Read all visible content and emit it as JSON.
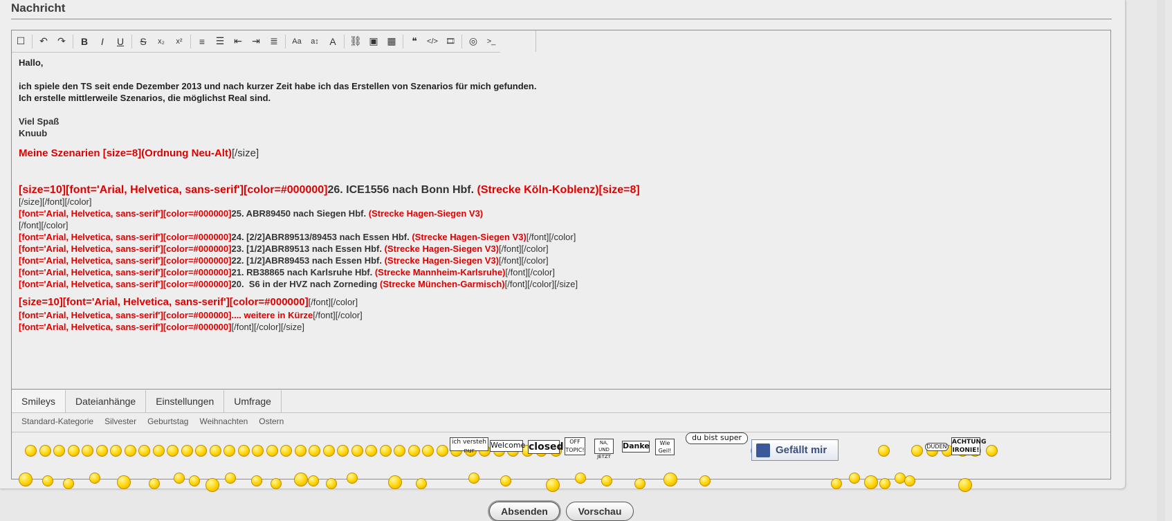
{
  "section_heading": "Nachricht",
  "toolbar": {
    "buttons": [
      {
        "name": "source-mode-icon",
        "glyph": "☐"
      },
      {
        "name": "undo-icon",
        "glyph": "↶"
      },
      {
        "name": "redo-icon",
        "glyph": "↷"
      },
      {
        "name": "bold-icon",
        "glyph": "B"
      },
      {
        "name": "italic-icon",
        "glyph": "I"
      },
      {
        "name": "underline-icon",
        "glyph": "U"
      },
      {
        "name": "strikethrough-icon",
        "glyph": "S"
      },
      {
        "name": "subscript-icon",
        "glyph": "x₂"
      },
      {
        "name": "superscript-icon",
        "glyph": "x²"
      },
      {
        "name": "ordered-list-icon",
        "glyph": "≡"
      },
      {
        "name": "unordered-list-icon",
        "glyph": "☰"
      },
      {
        "name": "outdent-icon",
        "glyph": "⇤"
      },
      {
        "name": "indent-icon",
        "glyph": "⇥"
      },
      {
        "name": "align-icon",
        "glyph": "≣"
      },
      {
        "name": "font-family-icon",
        "glyph": "Aa"
      },
      {
        "name": "font-size-icon",
        "glyph": "a↕"
      },
      {
        "name": "font-color-icon",
        "glyph": "A"
      },
      {
        "name": "link-icon",
        "glyph": "⛓"
      },
      {
        "name": "image-icon",
        "glyph": "▣"
      },
      {
        "name": "table-icon",
        "glyph": "▦"
      },
      {
        "name": "quote-icon",
        "glyph": "❝"
      },
      {
        "name": "code-icon",
        "glyph": "</>"
      },
      {
        "name": "media-icon",
        "glyph": "🎞"
      },
      {
        "name": "spoiler-icon",
        "glyph": "◎"
      },
      {
        "name": "terminal-icon",
        "glyph": ">_"
      }
    ]
  },
  "message": {
    "greeting": "Hallo,",
    "p1": "ich spiele den TS seit ende Dezember 2013 und nach kurzer Zeit habe ich das Erstellen von Szenarios für mich gefunden.",
    "p2": "Ich erstelle mittlerweile Szenarios, die möglichst Real sind.",
    "sign1": "Viel Spaß",
    "sign2": "Knuub",
    "scen_head_red": "Meine Szenarien [size=8](Ordnung Neu-Alt)",
    "scen_head_tail": "[/size]",
    "l26_red": "[size=10][font='Arial, Helvetica, sans-serif'][color=#000000]",
    "l26_black": "26. ICE1556 nach Bonn Hbf. ",
    "l26_route": "(Strecke Köln-Koblenz)[size=8]",
    "l26_close": "[/size][/font][/color]",
    "l25_red": "[font='Arial, Helvetica, sans-serif'][color=#000000]",
    "l25_black": "25. ABR89450 nach Siegen Hbf. ",
    "l25_route": "(Strecke Hagen-Siegen V3)",
    "l25_close": "[/font][/color]",
    "l24_red": "[font='Arial, Helvetica, sans-serif'][color=#000000]",
    "l24_black": "24. [2/2]ABR89513/89453 nach Essen Hbf. ",
    "l24_route": "(Strecke Hagen-Siegen V3)",
    "l24_close": "[/font][/color]",
    "l23_red": "[font='Arial, Helvetica, sans-serif'][color=#000000]",
    "l23_black": "23. [1/2]ABR89513 nach Essen Hbf. ",
    "l23_route": "(Strecke Hagen-Siegen V3)",
    "l23_close": "[/font][/color]",
    "l22_red": "[font='Arial, Helvetica, sans-serif'][color=#000000]",
    "l22_black": "22. [1/2]ABR89453 nach Essen Hbf. ",
    "l22_route": "(Strecke Hagen-Siegen V3)",
    "l22_close": "[/font][/color]",
    "l21_red": "[font='Arial, Helvetica, sans-serif'][color=#000000]",
    "l21_black": "21. RB38865 nach Karlsruhe Hbf. ",
    "l21_route": "(Strecke Mannheim-Karlsruhe)",
    "l21_close": "[/font][/color]",
    "l20_red": "[font='Arial, Helvetica, sans-serif'][color=#000000]",
    "l20_black": "20.  S6 in der HVZ nach Zorneding ",
    "l20_route": "(Strecke München-Garmisch)",
    "l20_close": "[/font][/color][/size]",
    "lx_red": "[size=10][font='Arial, Helvetica, sans-serif'][color=#000000]",
    "lx_close": "[/font][/color]",
    "ly_red": "[font='Arial, Helvetica, sans-serif'][color=#000000].... weitere in Kürze",
    "ly_close": "[/font][/color]",
    "lz_red": "[font='Arial, Helvetica, sans-serif'][color=#000000]",
    "lz_close": "[/font][/color][/size]"
  },
  "tabs": [
    "Smileys",
    "Dateianhänge",
    "Einstellungen",
    "Umfrage"
  ],
  "smiley_categories": [
    "Standard-Kategorie",
    "Silvester",
    "Geburtstag",
    "Weihnachten",
    "Ostern"
  ],
  "signs": {
    "versteh": "ich versteh nur",
    "welcome": "Welcome",
    "closed": "closed",
    "offtopic": "OFF TOPIC!",
    "naund": "NA, UND JETZT",
    "danke": "Danke",
    "wiegeil": "Wie Geil!",
    "dubist": "du bist super",
    "duden": "DUDEN",
    "ironie": "ACHTUNG IRONIE!"
  },
  "like_label": "Gefällt mir",
  "buttons": {
    "submit": "Absenden",
    "preview": "Vorschau"
  },
  "colors": {
    "code_red": "#e00000",
    "background": "#eeeeee"
  }
}
